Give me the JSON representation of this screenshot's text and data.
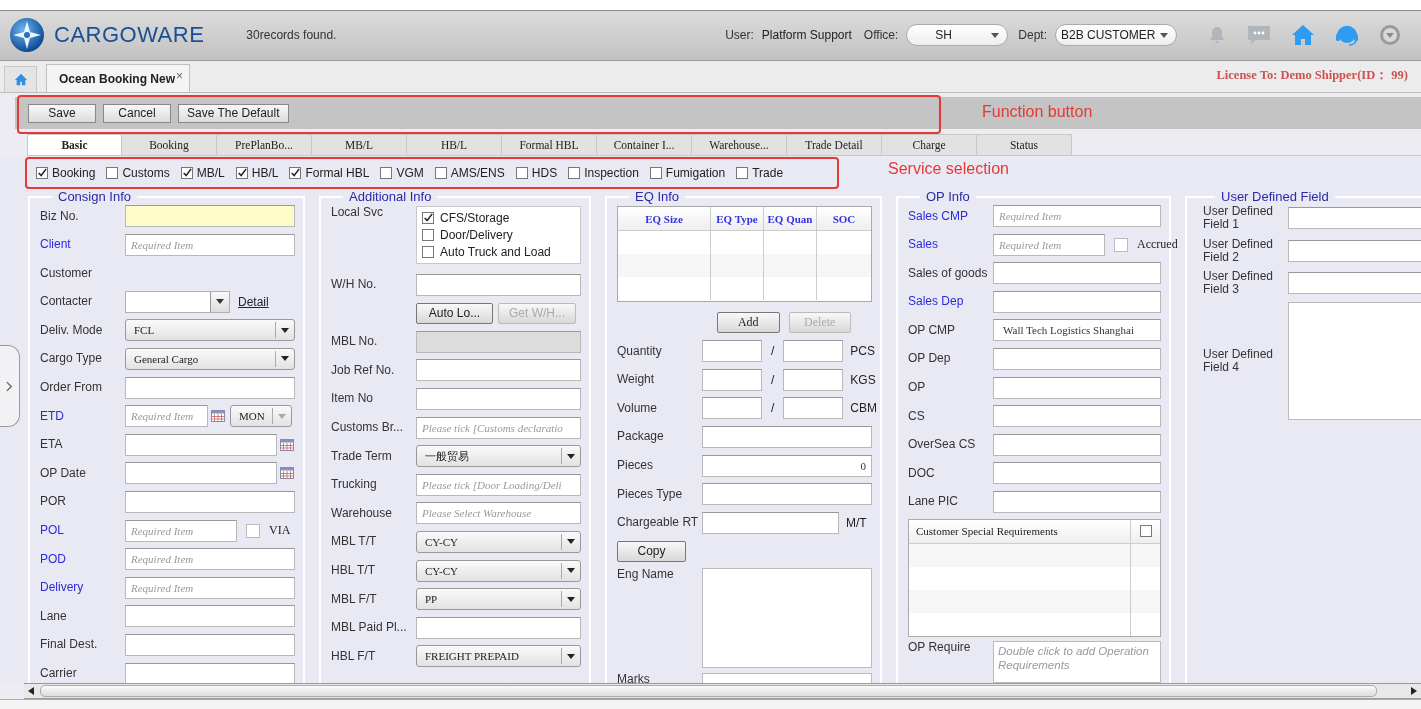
{
  "header": {
    "logo": "CARGOWARE",
    "status": "30records found.",
    "user_label": "User:",
    "user": "Platform Support",
    "office_label": "Office:",
    "office": "SH",
    "dept_label": "Dept:",
    "dept": "B2B CUSTOMER"
  },
  "tab_bar": {
    "tabs": [
      {
        "label": "Ocean Booking New",
        "selected": true,
        "close": "×"
      }
    ],
    "license": "License To: Demo Shipper(ID： 99)"
  },
  "toolbar": {
    "buttons": [
      "Save",
      "Cancel",
      "Save The Default"
    ],
    "annotation": "Function button"
  },
  "form_tabs": [
    {
      "label": "Basic",
      "selected": true
    },
    {
      "label": "Booking",
      "selected": false
    },
    {
      "label": "PrePlanBo...",
      "selected": false
    },
    {
      "label": "MB/L",
      "selected": false
    },
    {
      "label": "HB/L",
      "selected": false
    },
    {
      "label": "Formal HBL",
      "selected": false
    },
    {
      "label": "Container I...",
      "selected": false
    },
    {
      "label": "Warehouse...",
      "selected": false
    },
    {
      "label": "Trade Detail",
      "selected": false
    },
    {
      "label": "Charge",
      "selected": false
    },
    {
      "label": "Status",
      "selected": false
    }
  ],
  "services": {
    "annotation": "Service selection",
    "items": [
      {
        "label": "Booking",
        "checked": true
      },
      {
        "label": "Customs",
        "checked": false
      },
      {
        "label": "MB/L",
        "checked": true
      },
      {
        "label": "HB/L",
        "checked": true
      },
      {
        "label": "Formal HBL",
        "checked": true
      },
      {
        "label": "VGM",
        "checked": false
      },
      {
        "label": "AMS/ENS",
        "checked": false
      },
      {
        "label": "HDS",
        "checked": false
      },
      {
        "label": "Inspection",
        "checked": false
      },
      {
        "label": "Fumigation",
        "checked": false
      },
      {
        "label": "Trade",
        "checked": false
      }
    ]
  },
  "columns": [
    {
      "title": "Consign Info",
      "rows": [
        {
          "kind": "text",
          "label": "Biz No.",
          "required": false,
          "highlighted": true
        },
        {
          "kind": "text",
          "label": "Client",
          "required": true,
          "placeholder": "Required Item"
        },
        {
          "kind": "label",
          "label": "Customer",
          "required": false
        },
        {
          "kind": "combo-link",
          "label": "Contacter",
          "required": false,
          "link": "Detail"
        },
        {
          "kind": "select",
          "label": "Deliv. Mode",
          "required": false,
          "value": "FCL"
        },
        {
          "kind": "select",
          "label": "Cargo Type",
          "required": false,
          "value": "General Cargo"
        },
        {
          "kind": "text",
          "label": "Order From",
          "required": false
        },
        {
          "kind": "date-select",
          "label": "ETD",
          "required": true,
          "placeholder": "Required Item",
          "select": "MON"
        },
        {
          "kind": "date",
          "label": "ETA",
          "required": false
        },
        {
          "kind": "date",
          "label": "OP Date",
          "required": false
        },
        {
          "kind": "text",
          "label": "POR",
          "required": false
        },
        {
          "kind": "check-field",
          "label": "POL",
          "required": true,
          "placeholder": "Required Item",
          "check": {
            "label": "VIA",
            "checked": false
          }
        },
        {
          "kind": "text",
          "label": "POD",
          "required": true,
          "placeholder": "Required Item"
        },
        {
          "kind": "text",
          "label": "Delivery",
          "required": true,
          "placeholder": "Required Item"
        },
        {
          "kind": "text",
          "label": "Lane",
          "required": false
        },
        {
          "kind": "text",
          "label": "Final Dest.",
          "required": false
        },
        {
          "kind": "text",
          "label": "Carrier",
          "required": false
        }
      ]
    },
    {
      "title": "Additional Info",
      "rows": [
        {
          "kind": "checklist",
          "label": "Local Svc",
          "required": false,
          "options": [
            {
              "label": "CFS/Storage",
              "checked": true
            },
            {
              "label": "Door/Delivery",
              "checked": false
            },
            {
              "label": "Auto Truck and Load",
              "checked": false
            }
          ]
        },
        {
          "kind": "text",
          "label": "W/H No.",
          "required": false
        },
        {
          "kind": "buttons",
          "buttons": [
            {
              "label": "Auto Lo...",
              "disabled": false
            },
            {
              "label": "Get W/H...",
              "disabled": true
            }
          ]
        },
        {
          "kind": "text",
          "label": "MBL No.",
          "required": false,
          "disabled": true
        },
        {
          "kind": "text",
          "label": "Job Ref No.",
          "required": false
        },
        {
          "kind": "text",
          "label": "Item No",
          "required": false
        },
        {
          "kind": "text",
          "label": "Customs Br...",
          "required": false,
          "placeholder": "Please tick [Customs declaratio"
        },
        {
          "kind": "select",
          "label": "Trade Term",
          "required": false,
          "value": "一般贸易"
        },
        {
          "kind": "text",
          "label": "Trucking",
          "required": false,
          "placeholder": "Please tick [Door Loading/Deli"
        },
        {
          "kind": "text",
          "label": "Warehouse",
          "required": false,
          "placeholder": "Please Select Warehouse"
        },
        {
          "kind": "select",
          "label": "MBL T/T",
          "required": false,
          "value": "CY-CY"
        },
        {
          "kind": "select",
          "label": "HBL T/T",
          "required": false,
          "value": "CY-CY"
        },
        {
          "kind": "select",
          "label": "MBL F/T",
          "required": false,
          "value": "PP"
        },
        {
          "kind": "text",
          "label": "MBL Paid Pl...",
          "required": false
        },
        {
          "kind": "select",
          "label": "HBL F/T",
          "required": false,
          "value": "FREIGHT PREPAID"
        }
      ]
    },
    {
      "title": "EQ Info",
      "rows": [
        {
          "kind": "table",
          "columns": [
            "EQ Size",
            "EQ Type",
            "EQ Quan",
            "SOC"
          ]
        },
        {
          "kind": "buttons",
          "buttons": [
            {
              "label": "Add",
              "disabled": false
            },
            {
              "label": "Delete",
              "disabled": true
            }
          ]
        },
        {
          "kind": "pair",
          "label": "Quantity",
          "required": false,
          "separator": "/",
          "unit": "PCS"
        },
        {
          "kind": "pair",
          "label": "Weight",
          "required": false,
          "separator": "/",
          "unit": "KGS"
        },
        {
          "kind": "pair",
          "label": "Volume",
          "required": false,
          "separator": "/",
          "unit": "CBM"
        },
        {
          "kind": "text",
          "label": "Package",
          "required": false
        },
        {
          "kind": "number",
          "label": "Pieces",
          "required": false,
          "value": "0"
        },
        {
          "kind": "text",
          "label": "Pieces Type",
          "required": false
        },
        {
          "kind": "unit",
          "label": "Chargeable RT",
          "required": false,
          "unit": "M/T"
        },
        {
          "kind": "button",
          "button": "Copy"
        },
        {
          "kind": "textarea",
          "label": "Eng Name",
          "required": false
        },
        {
          "kind": "textarea",
          "label": "Marks",
          "required": false
        }
      ]
    },
    {
      "title": "OP Info",
      "rows": [
        {
          "kind": "text",
          "label": "Sales CMP",
          "required": true,
          "placeholder": "Required Item"
        },
        {
          "kind": "check-field",
          "label": "Sales",
          "required": true,
          "placeholder": "Required Item",
          "check": {
            "label": "Accrued",
            "checked": false
          }
        },
        {
          "kind": "text",
          "label": "Sales of goods",
          "required": false
        },
        {
          "kind": "text",
          "label": "Sales Dep",
          "required": true
        },
        {
          "kind": "text",
          "label": "OP CMP",
          "required": false,
          "value": "Wall Tech Logistics Shanghai"
        },
        {
          "kind": "text",
          "label": "OP Dep",
          "required": false
        },
        {
          "kind": "text",
          "label": "OP",
          "required": false
        },
        {
          "kind": "text",
          "label": "CS",
          "required": false
        },
        {
          "kind": "text",
          "label": "OverSea CS",
          "required": false
        },
        {
          "kind": "text",
          "label": "DOC",
          "required": false
        },
        {
          "kind": "text",
          "label": "Lane PIC",
          "required": false
        },
        {
          "kind": "grid",
          "title": "Customer Special Requirements",
          "checked": false
        },
        {
          "kind": "textarea",
          "label": "OP Require",
          "required": false,
          "placeholder": "Double click to add Operation Requirements"
        }
      ]
    },
    {
      "title": "User Defined Field",
      "rows": [
        {
          "kind": "text",
          "label": "User Defined Field 1",
          "required": false
        },
        {
          "kind": "text",
          "label": "User Defined Field 2",
          "required": false
        },
        {
          "kind": "text",
          "label": "User Defined Field 3",
          "required": false
        },
        {
          "kind": "textarea",
          "label": "User Defined Field 4",
          "required": false
        }
      ]
    }
  ]
}
